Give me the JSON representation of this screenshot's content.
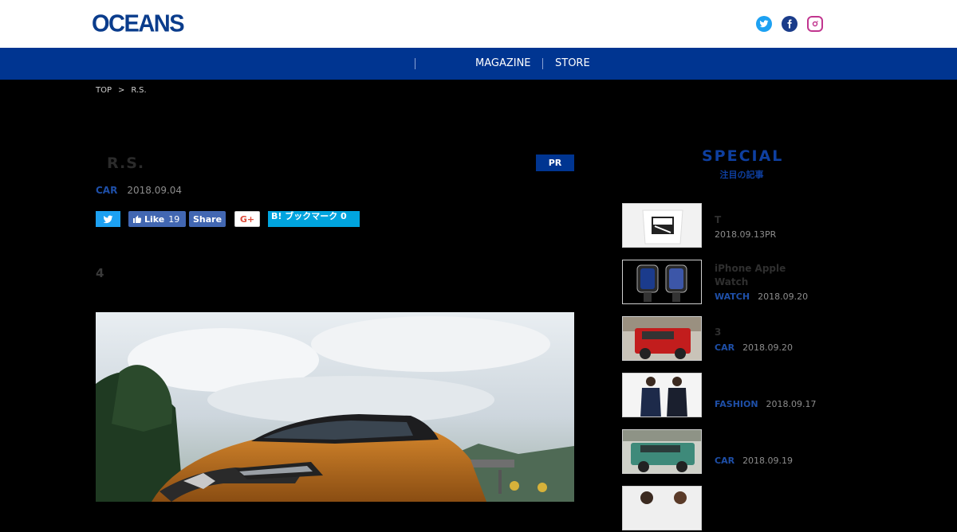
{
  "header": {
    "logo": "OCEANS",
    "social": [
      "twitter-icon",
      "facebook-icon",
      "instagram-icon"
    ]
  },
  "nav": {
    "items": [
      "MAGAZINE",
      "STORE"
    ]
  },
  "breadcrumb": {
    "top": "TOP",
    "sep": ">",
    "current": "R.S."
  },
  "article": {
    "title": "R.S.",
    "pr": "PR",
    "category": "CAR",
    "date": "2018.09.04",
    "lead": "4"
  },
  "share": {
    "fb_like": "Like",
    "fb_count": "19",
    "fb_share": "Share",
    "gplus": "G+",
    "hatena": "B! ブックマーク 0"
  },
  "special": {
    "title": "SPECIAL",
    "subtitle": "注目の記事"
  },
  "sidebar": [
    {
      "title": "T",
      "category": "",
      "date": "2018.09.13PR"
    },
    {
      "title": "iPhone Apple Watch",
      "category": "WATCH",
      "date": "2018.09.20"
    },
    {
      "title": "3",
      "category": "CAR",
      "date": "2018.09.20"
    },
    {
      "title": "",
      "category": "FASHION",
      "date": "2018.09.17"
    },
    {
      "title": "",
      "category": "CAR",
      "date": "2018.09.19"
    }
  ],
  "colors": {
    "brand": "#003591",
    "category": "#1e4fa8"
  }
}
